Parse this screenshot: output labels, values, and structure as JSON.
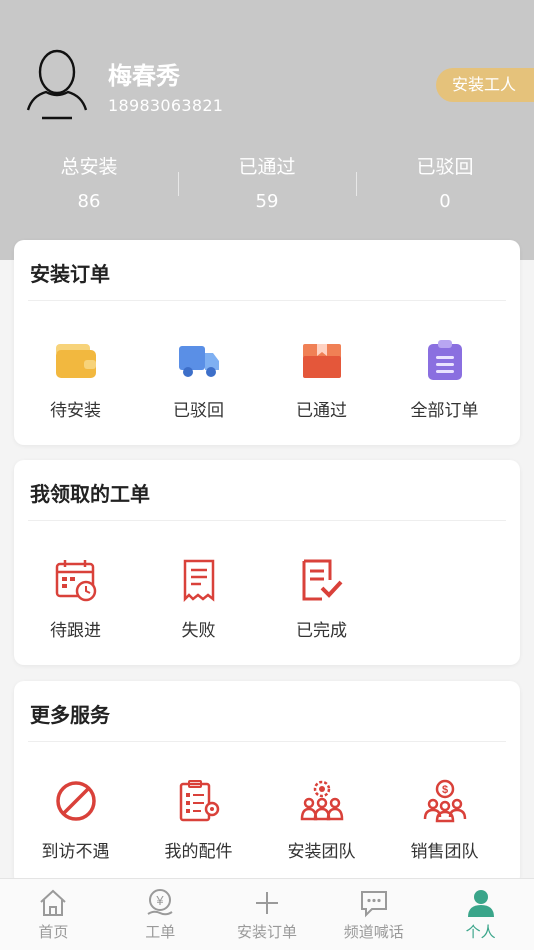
{
  "profile": {
    "name": "梅春秀",
    "phone": "18983063821",
    "role_badge": "安装工人"
  },
  "stats": [
    {
      "label": "总安装",
      "value": "86"
    },
    {
      "label": "已通过",
      "value": "59"
    },
    {
      "label": "已驳回",
      "value": "0"
    }
  ],
  "install_orders": {
    "title": "安装订单",
    "items": [
      {
        "label": "待安装",
        "icon": "wallet-icon"
      },
      {
        "label": "已驳回",
        "icon": "truck-icon"
      },
      {
        "label": "已通过",
        "icon": "box-icon"
      },
      {
        "label": "全部订单",
        "icon": "clipboard-icon"
      }
    ]
  },
  "my_work_orders": {
    "title": "我领取的工单",
    "items": [
      {
        "label": "待跟进",
        "icon": "calendar-clock-icon"
      },
      {
        "label": "失败",
        "icon": "receipt-icon"
      },
      {
        "label": "已完成",
        "icon": "document-check-icon"
      }
    ]
  },
  "more_services": {
    "title": "更多服务",
    "items": [
      {
        "label": "到访不遇",
        "icon": "prohibited-icon"
      },
      {
        "label": "我的配件",
        "icon": "checklist-gear-icon"
      },
      {
        "label": "安装团队",
        "icon": "team-gear-icon"
      },
      {
        "label": "销售团队",
        "icon": "sales-team-icon"
      }
    ]
  },
  "tabbar": {
    "items": [
      {
        "label": "首页",
        "icon": "home-icon"
      },
      {
        "label": "工单",
        "icon": "yuan-hand-icon"
      },
      {
        "label": "安装订单",
        "icon": "plus-icon"
      },
      {
        "label": "频道喊话",
        "icon": "chat-icon"
      },
      {
        "label": "个人",
        "icon": "person-icon"
      }
    ],
    "active_index": 4
  },
  "colors": {
    "header_bg": "#c8c8c8",
    "badge": "#e5c27b",
    "icon_red": "#d9413a",
    "tab_active": "#3aa58a",
    "tab_inactive": "#9a9a9a"
  }
}
